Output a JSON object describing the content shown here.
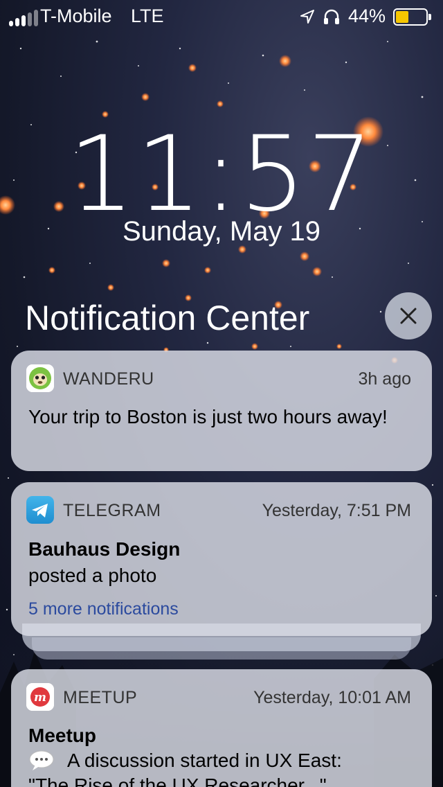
{
  "status_bar": {
    "carrier": "T-Mobile",
    "network": "LTE",
    "battery_percent": "44%",
    "icons": [
      "signal-icon",
      "location-icon",
      "headphones-icon",
      "battery-icon"
    ],
    "battery_color": "#f6c600"
  },
  "lock": {
    "time": "11:57",
    "date": "Sunday, May 19"
  },
  "notification_center": {
    "title": "Notification Center",
    "close_icon": "close-icon"
  },
  "notifications": [
    {
      "app": "WANDERU",
      "time": "3h ago",
      "message": "Your trip to Boston is just two hours away!",
      "icon": "wanderu-icon"
    },
    {
      "app": "TELEGRAM",
      "time": "Yesterday, 7:51 PM",
      "title": "Bauhaus Design",
      "message": "posted a photo",
      "more": "5 more notifications",
      "icon": "telegram-icon"
    },
    {
      "app": "MEETUP",
      "time": "Yesterday, 10:01 AM",
      "title": "Meetup",
      "message": "A discussion started in UX East:",
      "message_cont": "\"The Rise of the UX Researcher...\"",
      "icon": "meetup-icon"
    }
  ]
}
